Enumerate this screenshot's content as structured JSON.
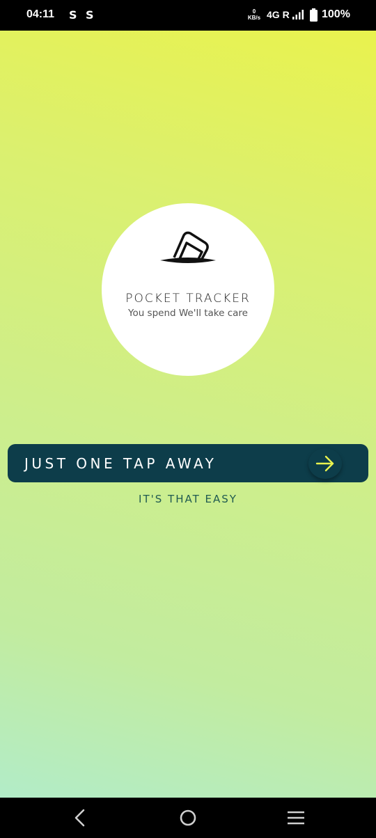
{
  "status_bar": {
    "time": "04:11",
    "notification_icons": [
      "S",
      "S"
    ],
    "data_speed_value": "0",
    "data_speed_unit": "KB/s",
    "network": "4G R",
    "signal_icon": "signal-bars-icon",
    "battery_icon": "battery-full-icon",
    "battery_percent": "100%"
  },
  "splash": {
    "logo_icon": "wallet-card-icon",
    "app_title": "POCKET TRACKER",
    "tagline": "You spend We'll take care",
    "cta_label": "JUST ONE TAP AWAY",
    "cta_icon": "arrow-right-icon",
    "caption": "IT'S THAT EASY"
  },
  "nav_bar": {
    "back_icon": "back-chevron-icon",
    "home_icon": "home-circle-icon",
    "menu_icon": "recents-menu-icon"
  },
  "colors": {
    "button_bg": "#0d3d4a",
    "arrow_accent": "#e9f24e",
    "caption_text": "#1f5a50",
    "gradient_top": "#e9f24e",
    "gradient_bottom": "#b2ecc8"
  }
}
